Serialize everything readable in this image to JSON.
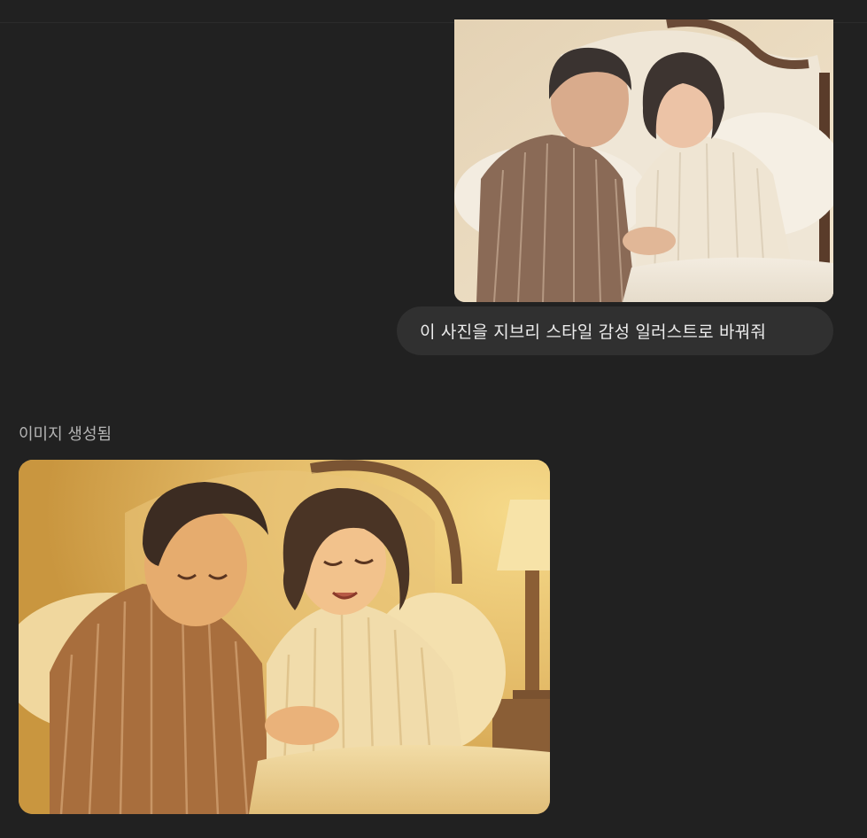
{
  "conversation": {
    "user_message": {
      "photo": {
        "kind": "photo",
        "subject": "couple-in-pajamas-on-bed"
      },
      "text": "이 사진을 지브리 스타일 감성 일러스트로 바꿔줘"
    },
    "assistant_message": {
      "status_label": "이미지 생성됨",
      "image": {
        "kind": "illustration",
        "subject": "couple-in-pajamas-on-bed-ghibli-style"
      }
    }
  },
  "colors": {
    "background": "#212121",
    "bubble": "#303030",
    "text": "#ececec",
    "muted_text": "#b4b4b4"
  }
}
